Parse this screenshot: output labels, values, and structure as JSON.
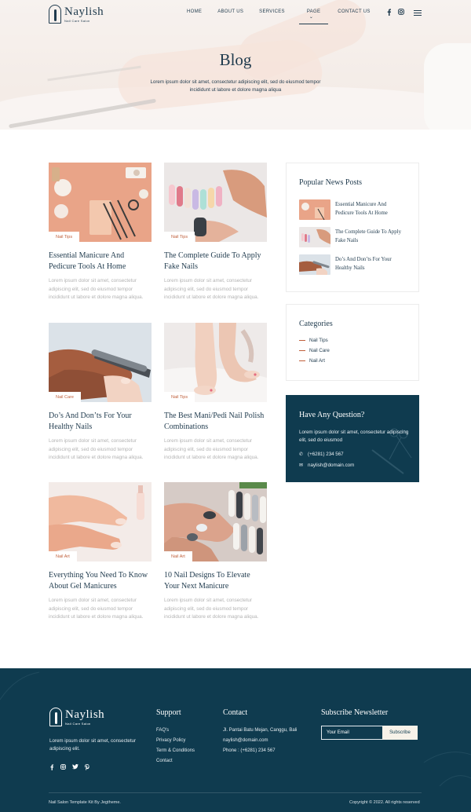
{
  "brand": {
    "name": "Naylish",
    "tagline": "Nail Care Salon"
  },
  "nav": {
    "items": [
      "HOME",
      "ABOUT US",
      "SERVICES",
      "PAGE",
      "CONTACT US"
    ],
    "social": [
      "facebook-icon",
      "instagram-icon"
    ]
  },
  "hero": {
    "title": "Blog",
    "subtitle": "Lorem ipsum dolor sit amet, consectetur adipiscing elit, sed do eiusmod tempor incididunt ut labore et dolore magna aliqua"
  },
  "posts": [
    {
      "tag": "Nail Tips",
      "title": "Essential Manicure And Pedicure Tools At Home",
      "excerpt": "Lorem ipsum dolor sit amet, consectetur adipiscing elit, sed do eiusmod tempor incididunt ut labore et dolore magna aliqua."
    },
    {
      "tag": "Nail Tips",
      "title": "The Complete Guide To Apply Fake Nails",
      "excerpt": "Lorem ipsum dolor sit amet, consectetur adipiscing elit, sed do eiusmod tempor incididunt ut labore et dolore magna aliqua."
    },
    {
      "tag": "Nail Care",
      "title": "Do’s And Don’ts For Your Healthy Nails",
      "excerpt": "Lorem ipsum dolor sit amet, consectetur adipiscing elit, sed do eiusmod tempor incididunt ut labore et dolore magna aliqua."
    },
    {
      "tag": "Nail Tips",
      "title": "The Best Mani/Pedi Nail Polish Combinations",
      "excerpt": "Lorem ipsum dolor sit amet, consectetur adipiscing elit, sed do eiusmod tempor incididunt ut labore et dolore magna aliqua."
    },
    {
      "tag": "Nail Art",
      "title": "Everything You Need To Know About Gel Manicures",
      "excerpt": "Lorem ipsum dolor sit amet, consectetur adipiscing elit, sed do eiusmod tempor incididunt ut labore et dolore magna aliqua."
    },
    {
      "tag": "Nail Art",
      "title": "10 Nail Designs To Elevate Your Next Manicure",
      "excerpt": "Lorem ipsum dolor sit amet, consectetur adipiscing elit, sed do eiusmod tempor incididunt ut labore et dolore magna aliqua."
    }
  ],
  "sidebar": {
    "popular": {
      "title": "Popular News Posts",
      "items": [
        "Essential Manicure And Pedicure Tools At Home",
        "The Complete Guide To Apply Fake Nails",
        "Do’s And Don’ts For Your Healthy Nails"
      ]
    },
    "categories": {
      "title": "Categories",
      "items": [
        "Nail Tips",
        "Nail Care",
        "Nail Art"
      ]
    },
    "question": {
      "title": "Have Any Question?",
      "text": "Lorem ipsum dolor sit amet, consectetur adipiscing elit, sed do eiusmod",
      "phone": "(+6281) 234 567",
      "email": "naylish@domain.com"
    }
  },
  "footer": {
    "description": "Lorem ipsum dolor sit amet, consectetur adipiscing elit.",
    "support": {
      "title": "Support",
      "links": [
        "FAQ's",
        "Privacy Policy",
        "Term & Conditions",
        "Contact"
      ]
    },
    "contact": {
      "title": "Contact",
      "lines": [
        "Jl. Pantai Batu Mejan, Canggu, Bali",
        "naylish@domain.com",
        "Phone : (+6281) 234 567"
      ]
    },
    "newsletter": {
      "title": "Subscribe Newsletter",
      "placeholder": "Your Email",
      "button": "Subscribe"
    },
    "credit": "Nail Salon Template Kit By Jegtheme.",
    "copyright": "Copyright © 2022. All rights reserved"
  },
  "colors": {
    "primary": "#0f3b4f",
    "accent": "#c0603c",
    "text": "#1f3a4d"
  }
}
